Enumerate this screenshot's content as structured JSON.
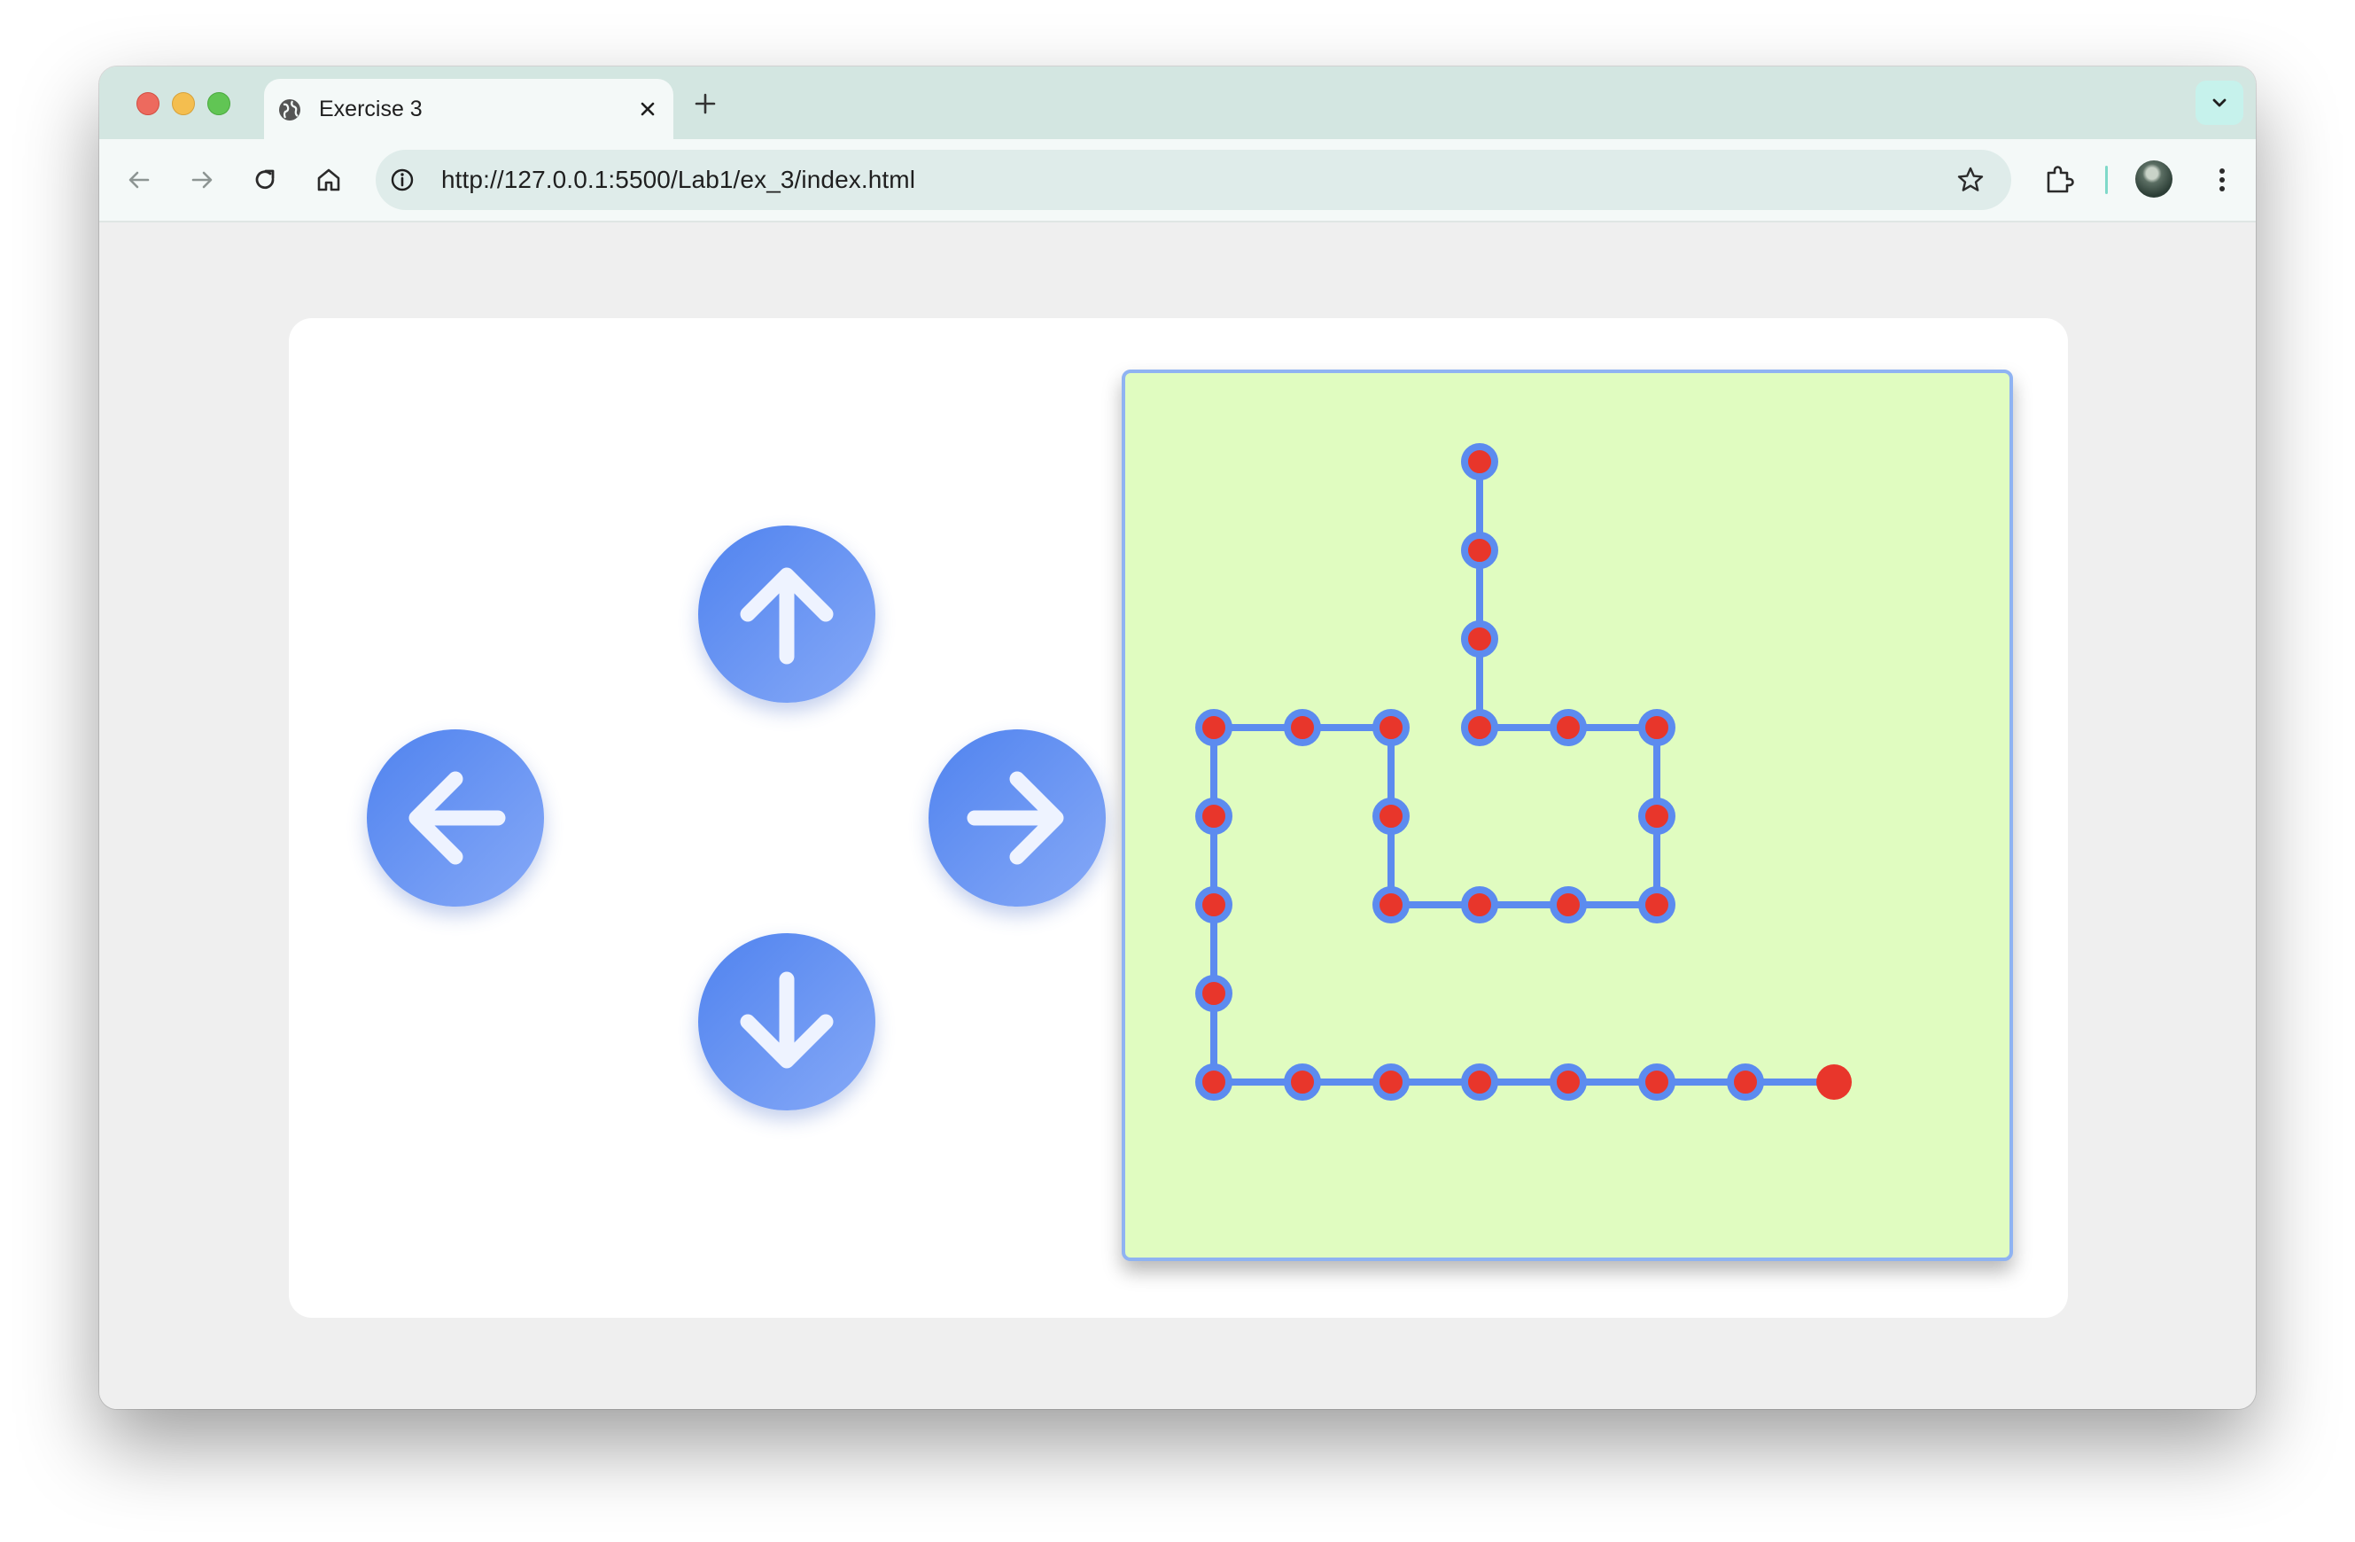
{
  "browser": {
    "tab": {
      "title": "Exercise 3"
    },
    "address_bar": {
      "url": "http://127.0.0.1:5500/Lab1/ex_3/index.html"
    }
  },
  "controls": {
    "buttons": [
      {
        "name": "up-arrow-button",
        "icon": "arrow-up-icon"
      },
      {
        "name": "left-arrow-button",
        "icon": "arrow-left-icon"
      },
      {
        "name": "right-arrow-button",
        "icon": "arrow-right-icon"
      },
      {
        "name": "down-arrow-button",
        "icon": "arrow-down-icon"
      }
    ]
  },
  "board": {
    "background_color": "#e0fcc0",
    "path_color": "#5c8bef",
    "dot_color": "#e8362b",
    "path": [
      [
        4,
        1
      ],
      [
        4,
        2
      ],
      [
        4,
        3
      ],
      [
        4,
        4
      ],
      [
        5,
        4
      ],
      [
        6,
        4
      ],
      [
        6,
        5
      ],
      [
        6,
        6
      ],
      [
        5,
        6
      ],
      [
        4,
        6
      ],
      [
        3,
        6
      ],
      [
        3,
        5
      ],
      [
        3,
        4
      ],
      [
        2,
        4
      ],
      [
        1,
        4
      ],
      [
        1,
        5
      ],
      [
        1,
        6
      ],
      [
        1,
        7
      ],
      [
        1,
        8
      ],
      [
        2,
        8
      ],
      [
        3,
        8
      ],
      [
        4,
        8
      ],
      [
        5,
        8
      ],
      [
        6,
        8
      ],
      [
        7,
        8
      ],
      [
        8,
        8
      ]
    ],
    "head": [
      8,
      8
    ]
  }
}
